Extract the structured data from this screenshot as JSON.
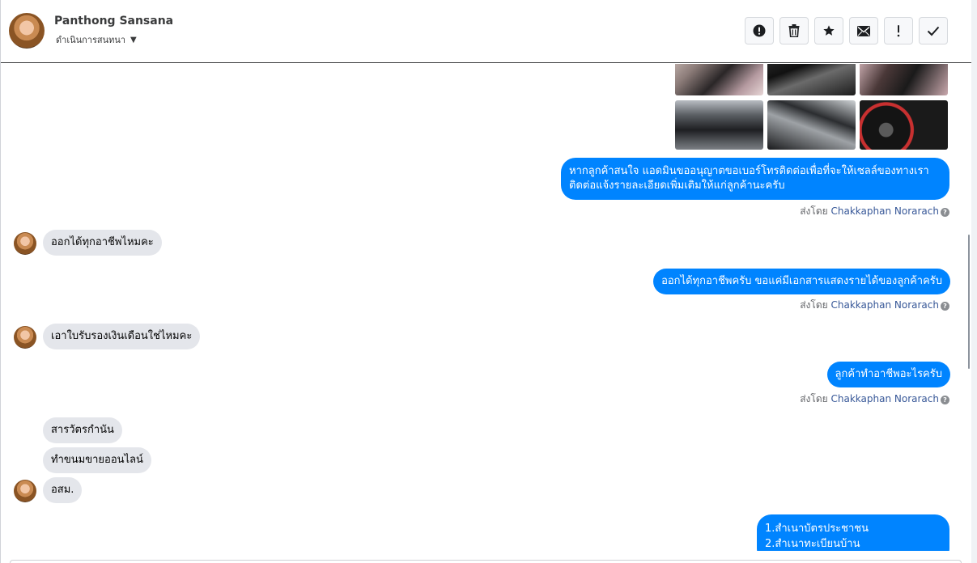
{
  "header": {
    "contact_name": "Panthong Sansana",
    "conversation_actions_label": "ดำเนินการสนทนา",
    "toolbar": [
      {
        "icon": "alert-circle-icon",
        "label": "Mark as spam"
      },
      {
        "icon": "trash-icon",
        "label": "Delete"
      },
      {
        "icon": "star-icon",
        "label": "Star"
      },
      {
        "icon": "envelope-icon",
        "label": "Mark as unread"
      },
      {
        "icon": "exclamation-icon",
        "label": "Follow up"
      },
      {
        "icon": "checkmark-icon",
        "label": "Mark as done"
      }
    ]
  },
  "thread": {
    "messages": [
      {
        "direction": "out",
        "text": "หากลูกค้าสนใจ แอดมินขออนุญาตขอเบอร์โทรติดต่อเพื่อที่จะให้เซลล์ของทางเราติดต่อแจ้งรายละเอียดเพิ่มเติมให้แก่ลูกค้านะครับ"
      },
      {
        "direction": "in",
        "text": "ออกได้ทุกอาชีพไหมคะ"
      },
      {
        "direction": "out",
        "text": "ออกได้ทุกอาชีพครับ ขอแค่มีเอกสารแสดงรายได้ของลูกค้าครับ"
      },
      {
        "direction": "in",
        "text": "เอาใบรับรองเงินเดือนใช่ไหมคะ"
      },
      {
        "direction": "out",
        "text": "ลูกค้าทำอาชีพอะไรครับ"
      },
      {
        "direction": "in",
        "text": "สารวัตรกำนัน"
      },
      {
        "direction": "in",
        "text": "ทำขนมขายออนไลน์"
      },
      {
        "direction": "in",
        "text": "อสม."
      },
      {
        "direction": "out",
        "lines": [
          "1.สำเนาบัตรประชาชน",
          "2.สำเนาทะเบียนบ้าน"
        ]
      }
    ],
    "sent_by": {
      "prefix": "ส่งโดย",
      "agent": "Chakkaphan Norarach"
    }
  }
}
